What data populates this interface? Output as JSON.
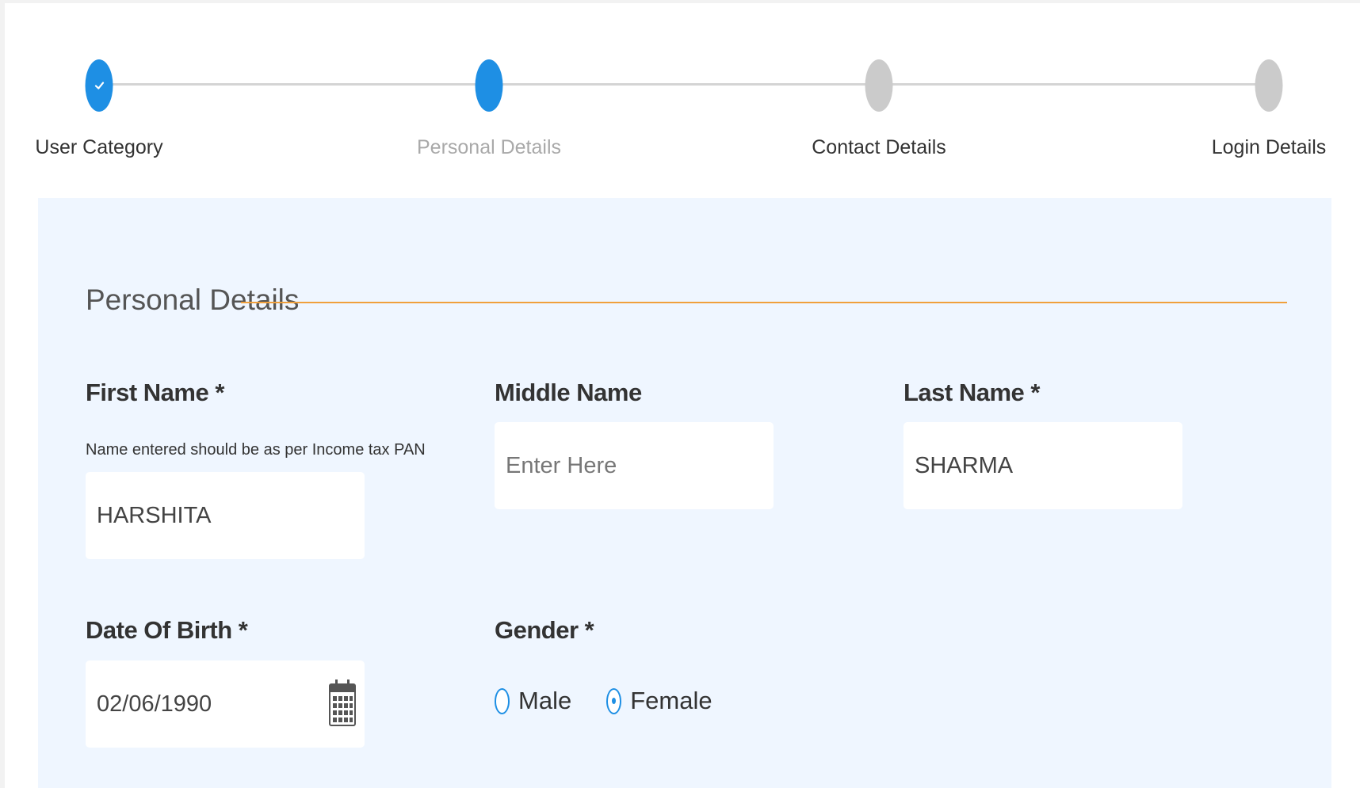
{
  "stepper": {
    "steps": [
      {
        "label": "User Category",
        "state": "completed"
      },
      {
        "label": "Personal Details",
        "state": "active"
      },
      {
        "label": "Contact Details",
        "state": "pending"
      },
      {
        "label": "Login Details",
        "state": "pending"
      }
    ]
  },
  "section": {
    "title": "Personal Details"
  },
  "form": {
    "first_name": {
      "label": "First Name *",
      "hint": "Name entered should be as per Income tax PAN",
      "value": "HARSHITA"
    },
    "middle_name": {
      "label": "Middle Name",
      "placeholder": "Enter Here",
      "value": ""
    },
    "last_name": {
      "label": "Last Name *",
      "value": "SHARMA"
    },
    "date_of_birth": {
      "label": "Date Of Birth *",
      "value": "02/06/1990",
      "icon": "calendar-icon"
    },
    "gender": {
      "label": "Gender *",
      "options": [
        {
          "label": "Male",
          "selected": false
        },
        {
          "label": "Female",
          "selected": true
        }
      ]
    }
  },
  "colors": {
    "accent": "#1e8fe4",
    "pending": "#cbcbcb",
    "section_rule": "#f0a03c",
    "panel_background": "#eff6ff"
  }
}
